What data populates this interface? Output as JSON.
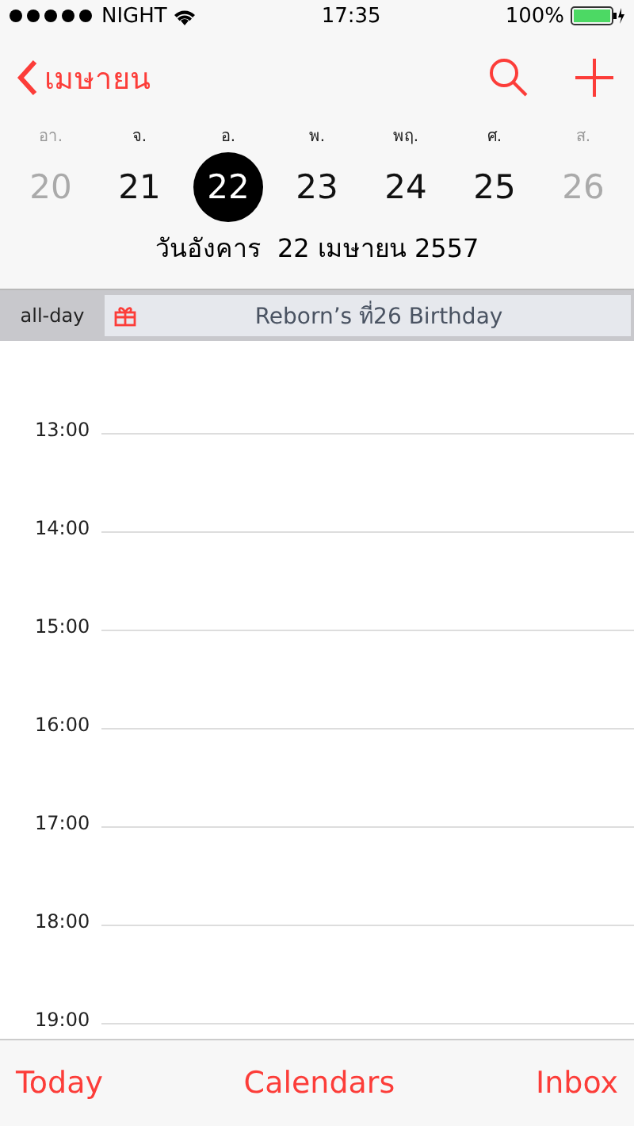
{
  "status_bar": {
    "carrier": "NIGHT",
    "time": "17:35",
    "battery": "100%"
  },
  "nav": {
    "back": "เมษายน"
  },
  "days": [
    {
      "weekday": "อา.",
      "date": "20",
      "selected": false,
      "weekend": true
    },
    {
      "weekday": "จ.",
      "date": "21",
      "selected": false,
      "weekend": false
    },
    {
      "weekday": "อ.",
      "date": "22",
      "selected": true,
      "weekend": false
    },
    {
      "weekday": "พ.",
      "date": "23",
      "selected": false,
      "weekend": false
    },
    {
      "weekday": "พฤ.",
      "date": "24",
      "selected": false,
      "weekend": false
    },
    {
      "weekday": "ศ.",
      "date": "25",
      "selected": false,
      "weekend": false
    },
    {
      "weekday": "ส.",
      "date": "26",
      "selected": false,
      "weekend": true
    }
  ],
  "date_title": "วันอังคาร  22 เมษายน 2557",
  "all_day": {
    "label": "all-day",
    "event": "Reborn’s ที่26 Birthday"
  },
  "hours": [
    "13:00",
    "14:00",
    "15:00",
    "16:00",
    "17:00",
    "18:00",
    "19:00"
  ],
  "tab_bar": [
    "Today",
    "Calendars",
    "Inbox"
  ]
}
